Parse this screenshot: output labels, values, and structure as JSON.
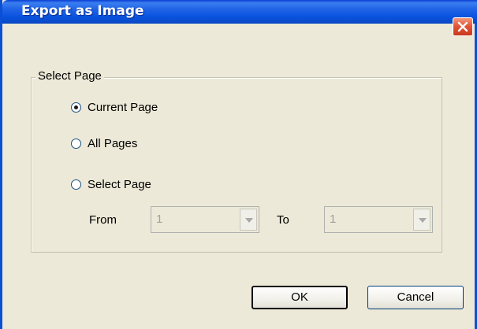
{
  "window": {
    "title": "Export as Image"
  },
  "group": {
    "title": "Select Page",
    "options": [
      {
        "label": "Current Page",
        "checked": true
      },
      {
        "label": "All Pages",
        "checked": false
      },
      {
        "label": "Select Page",
        "checked": false
      }
    ],
    "range": {
      "from_label": "From",
      "from_value": "1",
      "to_label": "To",
      "to_value": "1"
    }
  },
  "buttons": {
    "ok": "OK",
    "cancel": "Cancel"
  },
  "colors": {
    "titlebar": "#0a53e0",
    "close": "#e2563a",
    "dialog_bg": "#ece9d8"
  },
  "icons": {
    "close": "close-icon",
    "dropdown": "chevron-down-icon"
  }
}
